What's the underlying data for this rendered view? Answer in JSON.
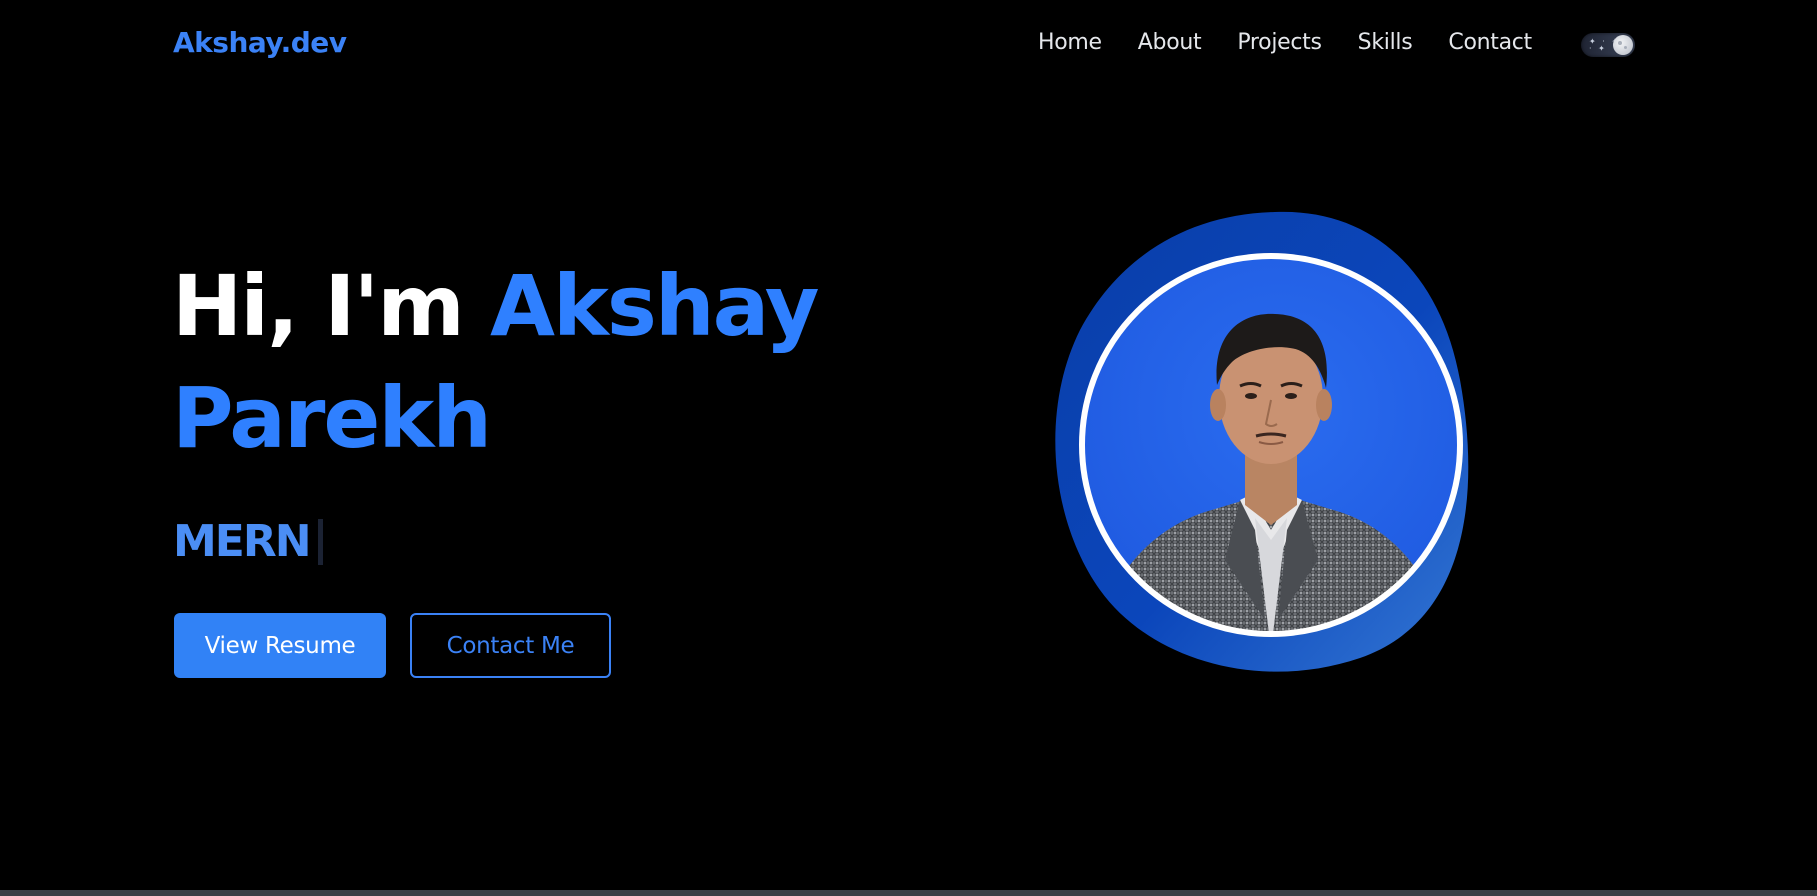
{
  "navbar": {
    "brand": "Akshay.dev",
    "links": [
      "Home",
      "About",
      "Projects",
      "Skills",
      "Contact"
    ],
    "theme_toggle_state": "dark"
  },
  "hero": {
    "greeting": "Hi, I'm ",
    "first_name": "Akshay",
    "last_name": "Parekh",
    "role": "MERN",
    "buttons": {
      "primary": "View Resume",
      "secondary": "Contact Me"
    }
  },
  "colors": {
    "background": "#000000",
    "accent": "#3b82f6",
    "blob_dark": "#0a3da8",
    "blob_light": "#2f6fd6",
    "photo_bg": "#2563eb"
  },
  "icons": {
    "theme_toggle": "moon-toggle-icon"
  }
}
